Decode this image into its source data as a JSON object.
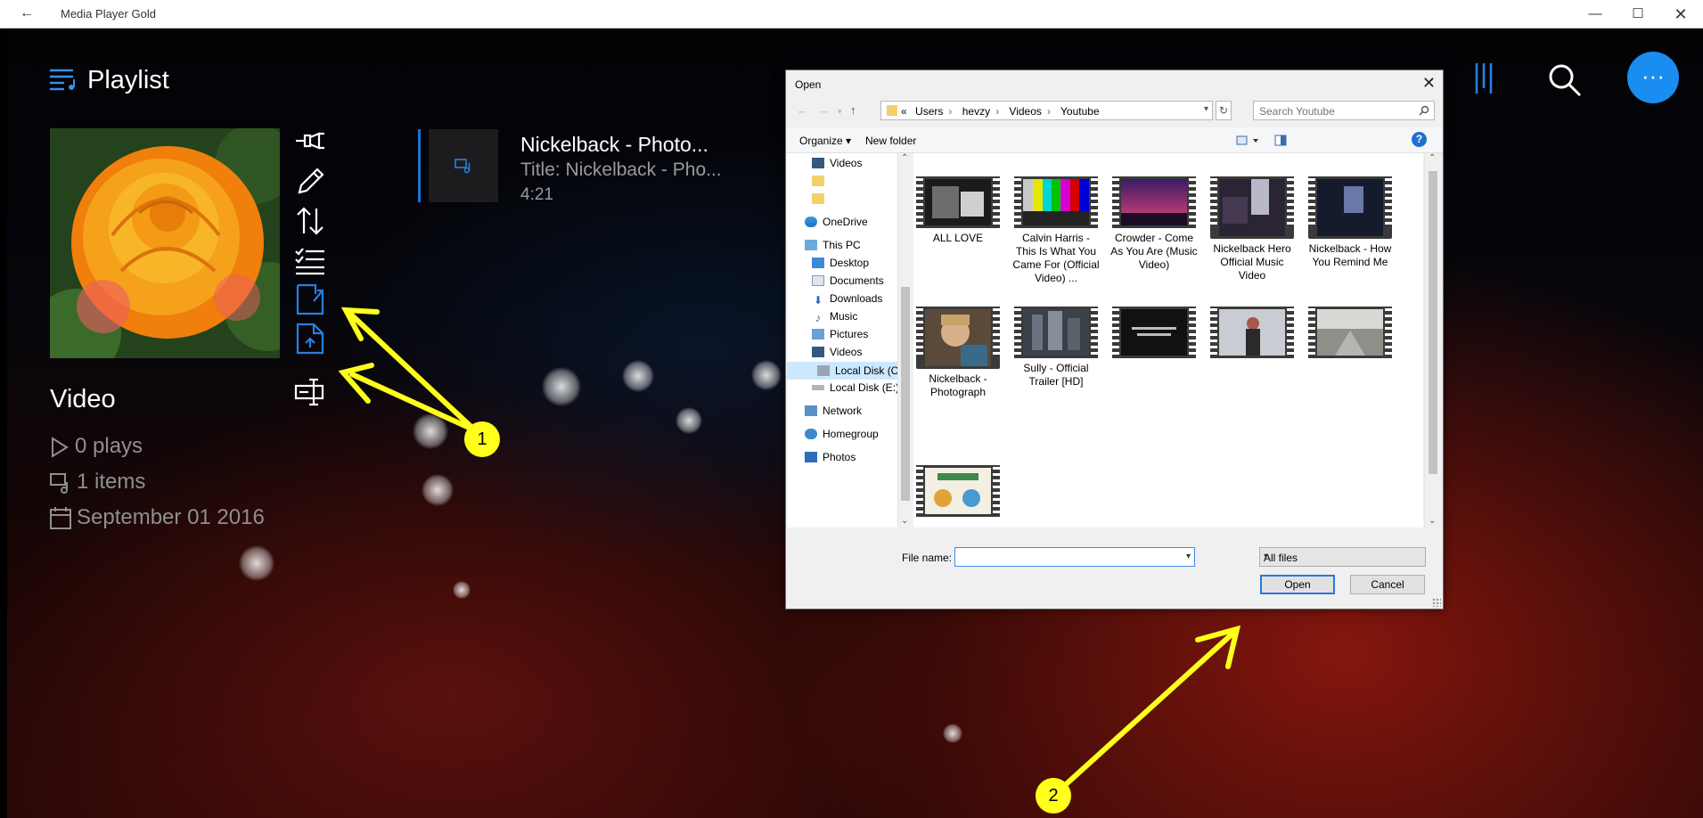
{
  "window": {
    "back_glyph": "←",
    "title": "Media Player Gold",
    "minimize": "—",
    "maximize": "☐",
    "close": "✕"
  },
  "app": {
    "page_title": "Playlist",
    "playlist_name": "Video",
    "plays": "0 plays",
    "items": "1 items",
    "date": "September 01 2016",
    "more_glyph": "···",
    "actions": [
      "pin-icon",
      "edit-icon",
      "sort-icon",
      "select-list-icon",
      "import-file-icon",
      "open-file-icon",
      "rename-icon"
    ],
    "track": {
      "name": "Nickelback - Photo...",
      "title": "Title: Nickelback - Pho...",
      "duration": "4:21"
    }
  },
  "annotations": {
    "marker_1": "1",
    "marker_2": "2",
    "color": "#ffff1a"
  },
  "dialog": {
    "title": "Open",
    "close": "✕",
    "breadcrumbs": [
      "«",
      "Users",
      "hevzy",
      "Videos",
      "Youtube"
    ],
    "search_placeholder": "Search Youtube",
    "organize": "Organize ▾",
    "new_folder": "New folder",
    "help": "?",
    "nav": [
      {
        "label": "Videos"
      },
      {
        "label": ""
      },
      {
        "label": ""
      },
      {
        "label": "OneDrive"
      },
      {
        "label": "This PC"
      },
      {
        "label": "Desktop"
      },
      {
        "label": "Documents"
      },
      {
        "label": "Downloads"
      },
      {
        "label": "Music"
      },
      {
        "label": "Pictures"
      },
      {
        "label": "Videos"
      },
      {
        "label": "Local Disk (C:)"
      },
      {
        "label": "Local Disk (E:)"
      },
      {
        "label": "Network"
      },
      {
        "label": "Homegroup"
      },
      {
        "label": "Photos"
      }
    ],
    "files": [
      {
        "label": "ALL LOVE"
      },
      {
        "label": "Calvin Harris - This Is What You Came For (Official Video) ..."
      },
      {
        "label": "Crowder - Come As You Are (Music Video)"
      },
      {
        "label": "Nickelback  Hero Official Music Video"
      },
      {
        "label": "Nickelback - How You Remind Me"
      },
      {
        "label": "Nickelback - Photograph"
      },
      {
        "label": "Sully - Official Trailer [HD]"
      },
      {
        "label": ""
      },
      {
        "label": ""
      },
      {
        "label": ""
      },
      {
        "label": ""
      }
    ],
    "file_name_label": "File name:",
    "file_name_value": "",
    "file_type": "All files",
    "open_button": "Open",
    "cancel_button": "Cancel"
  }
}
